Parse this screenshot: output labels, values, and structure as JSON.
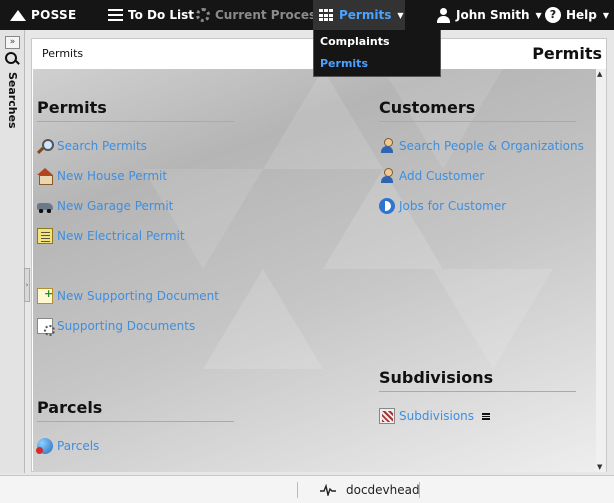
{
  "topbar": {
    "logo": "POSSE",
    "todo_label": "To Do List",
    "current_process_label": "Current Process",
    "permits_label": "Permits",
    "user_label": "John Smith",
    "help_label": "Help"
  },
  "dropdown": {
    "items": [
      {
        "label": "Complaints"
      },
      {
        "label": "Permits"
      }
    ]
  },
  "rail": {
    "label": "Searches"
  },
  "panel": {
    "breadcrumb": "Permits",
    "title": "Permits"
  },
  "sections": {
    "permits": {
      "title": "Permits",
      "links": [
        {
          "label": "Search Permits",
          "icon": "search-icon"
        },
        {
          "label": "New House Permit",
          "icon": "house-icon"
        },
        {
          "label": "New Garage Permit",
          "icon": "car-icon"
        },
        {
          "label": "New Electrical Permit",
          "icon": "document-icon"
        },
        {
          "label": "New Supporting Document",
          "icon": "new-document-icon"
        },
        {
          "label": "Supporting Documents",
          "icon": "documents-icon"
        }
      ]
    },
    "parcels": {
      "title": "Parcels",
      "links": [
        {
          "label": "Parcels",
          "icon": "globe-icon"
        }
      ]
    },
    "customers": {
      "title": "Customers",
      "links": [
        {
          "label": "Search People & Organizations",
          "icon": "person-search-icon"
        },
        {
          "label": "Add Customer",
          "icon": "person-add-icon"
        },
        {
          "label": "Jobs for Customer",
          "icon": "jobs-icon"
        }
      ]
    },
    "subdivisions": {
      "title": "Subdivisions",
      "links": [
        {
          "label": "Subdivisions",
          "icon": "subdivision-icon"
        }
      ]
    }
  },
  "footer": {
    "label": "docdevhead"
  },
  "colors": {
    "topbar_bg": "#151515",
    "active_accent": "#4aa3ff",
    "link": "#3d8fe0"
  }
}
